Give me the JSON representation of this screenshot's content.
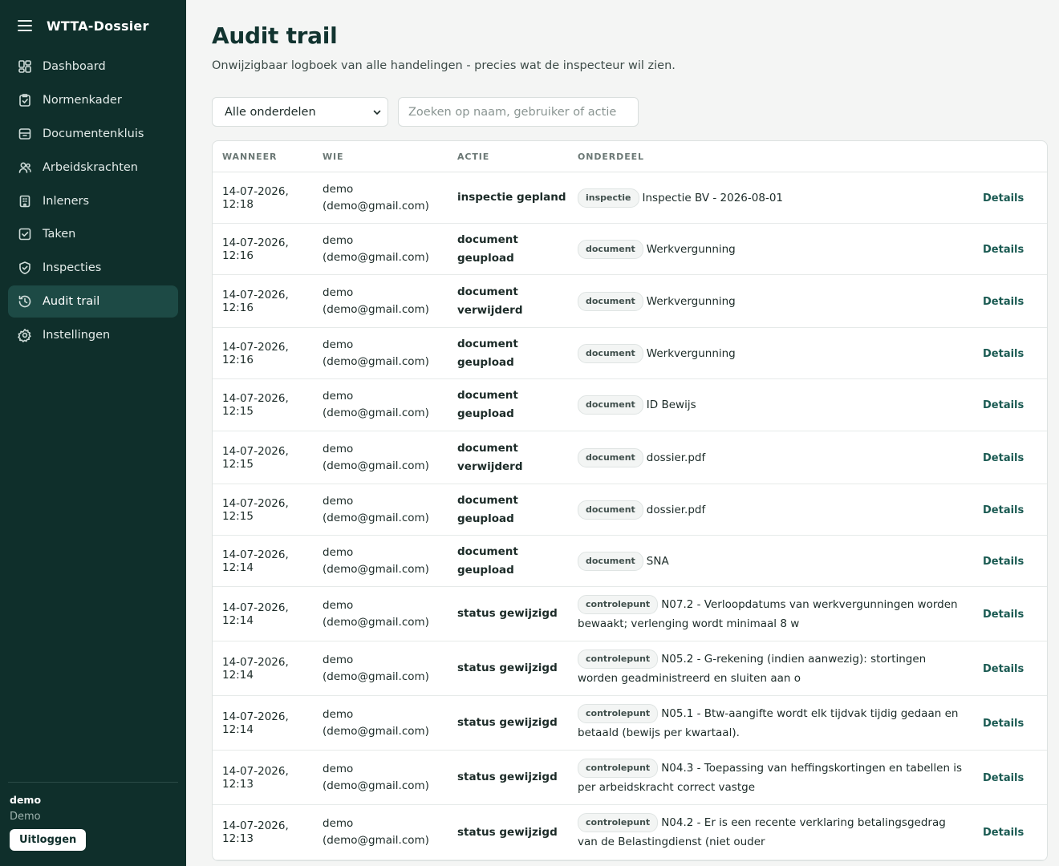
{
  "app": {
    "title": "WTTA-Dossier"
  },
  "sidebar": {
    "items": [
      {
        "label": "Dashboard",
        "icon": "dashboard-icon",
        "active": false
      },
      {
        "label": "Normenkader",
        "icon": "clipboard-check-icon",
        "active": false
      },
      {
        "label": "Documentenkluis",
        "icon": "archive-icon",
        "active": false
      },
      {
        "label": "Arbeidskrachten",
        "icon": "users-icon",
        "active": false
      },
      {
        "label": "Inleners",
        "icon": "building-icon",
        "active": false
      },
      {
        "label": "Taken",
        "icon": "checkbox-icon",
        "active": false
      },
      {
        "label": "Inspecties",
        "icon": "shield-check-icon",
        "active": false
      },
      {
        "label": "Audit trail",
        "icon": "history-icon",
        "active": true
      },
      {
        "label": "Instellingen",
        "icon": "gear-icon",
        "active": false
      }
    ],
    "user": {
      "name": "demo",
      "org": "Demo",
      "logout_label": "Uitloggen"
    }
  },
  "header": {
    "title": "Audit trail",
    "subtitle": "Onwijzigbaar logboek van alle handelingen - precies wat de inspecteur wil zien."
  },
  "filters": {
    "select_value": "Alle onderdelen",
    "search_placeholder": "Zoeken op naam, gebruiker of actie"
  },
  "table": {
    "columns": [
      "WANNEER",
      "WIE",
      "ACTIE",
      "ONDERDEEL",
      ""
    ],
    "rows": [
      {
        "when": "14-07-2026, 12:18",
        "who_name": "demo",
        "who_email": "(demo@gmail.com)",
        "action": "inspectie gepland",
        "badge": "inspectie",
        "part": "Inspectie BV - 2026-08-01",
        "details": "Details",
        "h": 64
      },
      {
        "when": "14-07-2026, 12:16",
        "who_name": "demo",
        "who_email": "(demo@gmail.com)",
        "action": "document geupload",
        "badge": "document",
        "part": "Werkvergunning",
        "details": "Details",
        "h": 64
      },
      {
        "when": "14-07-2026, 12:16",
        "who_name": "demo",
        "who_email": "(demo@gmail.com)",
        "action": "document verwijderd",
        "badge": "document",
        "part": "Werkvergunning",
        "details": "Details",
        "h": 66
      },
      {
        "when": "14-07-2026, 12:16",
        "who_name": "demo",
        "who_email": "(demo@gmail.com)",
        "action": "document geupload",
        "badge": "document",
        "part": "Werkvergunning",
        "details": "Details",
        "h": 64
      },
      {
        "when": "14-07-2026, 12:15",
        "who_name": "demo",
        "who_email": "(demo@gmail.com)",
        "action": "document geupload",
        "badge": "document",
        "part": "ID Bewijs",
        "details": "Details",
        "h": 65
      },
      {
        "when": "14-07-2026, 12:15",
        "who_name": "demo",
        "who_email": "(demo@gmail.com)",
        "action": "document verwijderd",
        "badge": "document",
        "part": "dossier.pdf",
        "details": "Details",
        "h": 66
      },
      {
        "when": "14-07-2026, 12:15",
        "who_name": "demo",
        "who_email": "(demo@gmail.com)",
        "action": "document geupload",
        "badge": "document",
        "part": "dossier.pdf",
        "details": "Details",
        "h": 64
      },
      {
        "when": "14-07-2026, 12:14",
        "who_name": "demo",
        "who_email": "(demo@gmail.com)",
        "action": "document geupload",
        "badge": "document",
        "part": "SNA",
        "details": "Details",
        "h": 64
      },
      {
        "when": "14-07-2026, 12:14",
        "who_name": "demo",
        "who_email": "(demo@gmail.com)",
        "action": "status gewijzigd",
        "badge": "controlepunt",
        "part": "N07.2 - Verloopdatums van werkvergunningen worden bewaakt; verlenging wordt minimaal 8 w",
        "details": "Details",
        "h": 68
      },
      {
        "when": "14-07-2026, 12:14",
        "who_name": "demo",
        "who_email": "(demo@gmail.com)",
        "action": "status gewijzigd",
        "badge": "controlepunt",
        "part": "N05.2 - G-rekening (indien aanwezig): stortingen worden geadministreerd en sluiten aan o",
        "details": "Details",
        "h": 68
      },
      {
        "when": "14-07-2026, 12:14",
        "who_name": "demo",
        "who_email": "(demo@gmail.com)",
        "action": "status gewijzigd",
        "badge": "controlepunt",
        "part": "N05.1 - Btw-aangifte wordt elk tijdvak tijdig gedaan en betaald (bewijs per kwartaal).",
        "details": "Details",
        "h": 68
      },
      {
        "when": "14-07-2026, 12:13",
        "who_name": "demo",
        "who_email": "(demo@gmail.com)",
        "action": "status gewijzigd",
        "badge": "controlepunt",
        "part": "N04.3 - Toepassing van heffingskortingen en tabellen is per arbeidskracht correct vastge",
        "details": "Details",
        "h": 68
      },
      {
        "when": "14-07-2026, 12:13",
        "who_name": "demo",
        "who_email": "(demo@gmail.com)",
        "action": "status gewijzigd",
        "badge": "controlepunt",
        "part": "N04.2 - Er is een recente verklaring betalingsgedrag van de Belastingdienst (niet ouder",
        "details": "Details",
        "h": 69
      }
    ]
  }
}
